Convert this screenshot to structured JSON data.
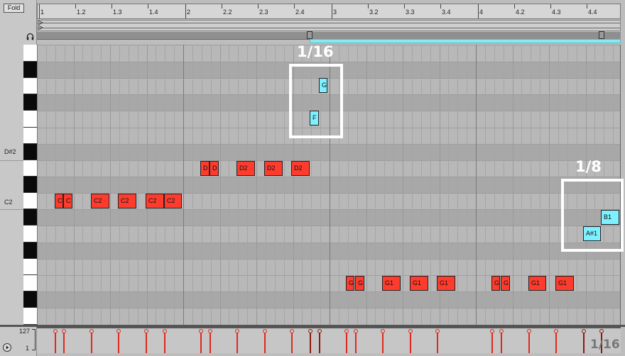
{
  "fold_label": "Fold",
  "ruler": {
    "labels": [
      "1",
      "1.2",
      "1.3",
      "1.4",
      "2",
      "2.2",
      "2.3",
      "2.4",
      "3",
      "3.2",
      "3.3",
      "3.4",
      "4",
      "4.2",
      "4.3",
      "4.4"
    ]
  },
  "key_labels": {
    "upper": "D#2",
    "lower": "C2"
  },
  "notes": [
    {
      "label": "C",
      "color": "red"
    },
    {
      "label": "C",
      "color": "red"
    },
    {
      "label": "C2",
      "color": "red"
    },
    {
      "label": "C2",
      "color": "red"
    },
    {
      "label": "C2",
      "color": "red"
    },
    {
      "label": "C2",
      "color": "red"
    },
    {
      "label": "D",
      "color": "red"
    },
    {
      "label": "D",
      "color": "red"
    },
    {
      "label": "D2",
      "color": "red"
    },
    {
      "label": "D2",
      "color": "red"
    },
    {
      "label": "D2",
      "color": "red"
    },
    {
      "label": "G",
      "color": "cyan"
    },
    {
      "label": "F",
      "color": "cyan"
    },
    {
      "label": "G",
      "color": "red"
    },
    {
      "label": "G",
      "color": "red"
    },
    {
      "label": "G1",
      "color": "red"
    },
    {
      "label": "G1",
      "color": "red"
    },
    {
      "label": "G1",
      "color": "red"
    },
    {
      "label": "G",
      "color": "red"
    },
    {
      "label": "G",
      "color": "red"
    },
    {
      "label": "G1",
      "color": "red"
    },
    {
      "label": "G1",
      "color": "red"
    },
    {
      "label": "A#1",
      "color": "cyan"
    },
    {
      "label": "B1",
      "color": "cyan"
    }
  ],
  "annotations": {
    "box1": "1/16",
    "box2": "1/8",
    "velocity": "1/16"
  },
  "velocity": {
    "max": "127",
    "min": "1"
  },
  "colors": {
    "note_red": "#ff3b2e",
    "note_cyan": "#7ff0ff",
    "selection": "#8fe6ee"
  }
}
